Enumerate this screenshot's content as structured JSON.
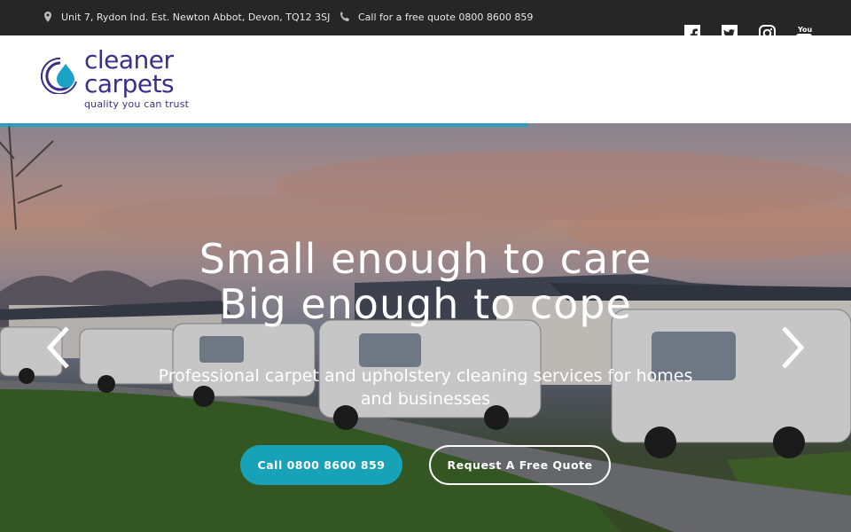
{
  "topbar": {
    "address": "Unit 7, Rydon Ind. Est. Newton Abbot, Devon, TQ12 3SJ",
    "phone": "Call for a free quote 0800 8600 859",
    "address_icon": "map-pin-icon",
    "phone_icon": "phone-icon",
    "social": [
      "facebook-icon",
      "twitter-icon",
      "instagram-icon",
      "youtube-icon"
    ]
  },
  "logo": {
    "word1": "cleaner",
    "word2": "carpets",
    "tagline": "quality you can trust",
    "colors": {
      "text": "#3b2f87",
      "drop": "#1aa3c4"
    }
  },
  "hero": {
    "line1": "Small enough to care",
    "line2": "Big enough to cope",
    "subtitle": "Professional carpet and upholstery cleaning services for homes and businesses",
    "call_button": "Call 0800 8600 859",
    "quote_button": "Request A Free Quote",
    "accent": "#17a2b8"
  }
}
